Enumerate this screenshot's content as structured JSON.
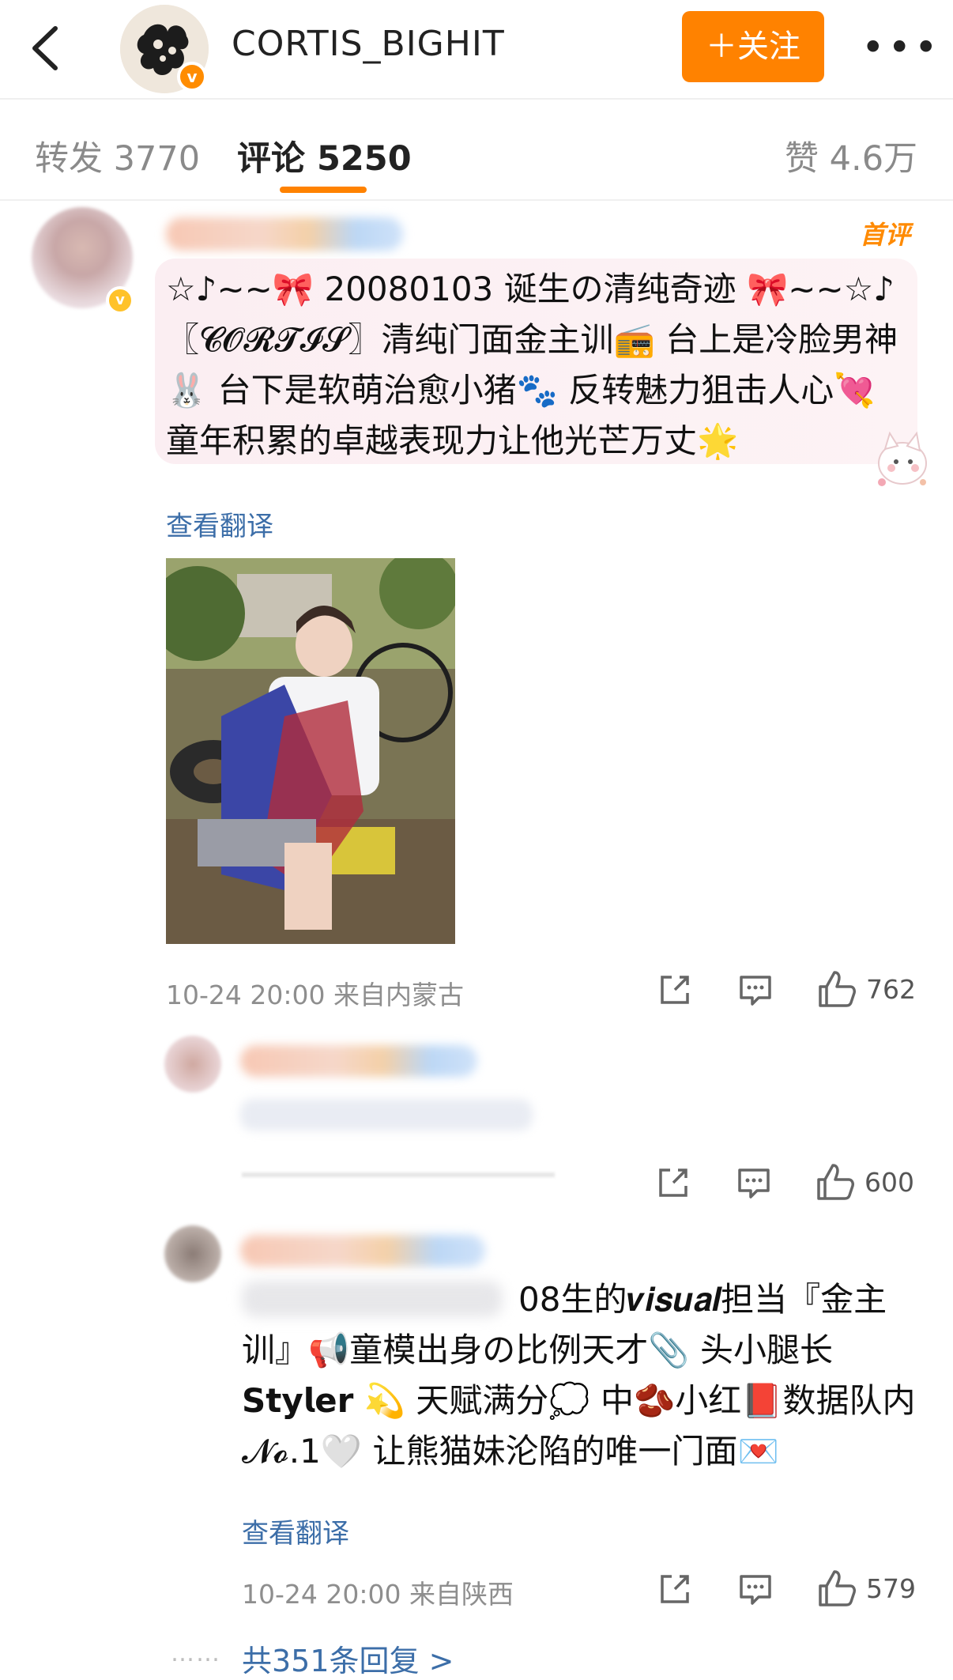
{
  "header": {
    "title": "CORTIS_BIGHIT",
    "follow_label": "＋关注",
    "more_label": "•••",
    "verified_mark": "v"
  },
  "tabs": {
    "repost": "转发 3770",
    "comment": "评论 5250",
    "like": "赞 4.6万"
  },
  "comments": [
    {
      "first_badge": "首评",
      "verified_mark": "v",
      "text": "☆♪~~🎀 20080103 诞生の清纯奇迹 🎀~~☆♪ 〖𝓒𝓞𝓡𝓣𝓘𝓢〗清纯门面金主训📻 台上是冷脸男神🐰 台下是软萌治愈小猪🐾 反转魅力狙击人心💘 童年积累的卓越表现力让他光芒万丈🌟",
      "translate_label": "查看翻译",
      "meta": "10-24 20:00  来自内蒙古",
      "likes": "762",
      "replies": [
        {
          "likes": "600"
        },
        {
          "text": "08生的𝒗𝒊𝒔𝒖𝒂𝒍担当『金主训』📢童模出身の比例天才📎 头小腿长𝗦𝘁𝘆𝗹𝗲𝗿 💫 天赋满分💭 中🫘小红📕数据队内𝓝𝓸.1🤍 让熊猫妹沦陷的唯一门面💌",
          "translate_label": "查看翻译",
          "meta": "10-24 20:00  来自陕西",
          "likes": "579",
          "more_replies_label": "共351条回复 >",
          "dots": "……"
        }
      ]
    }
  ],
  "colors": {
    "accent": "#ff8200",
    "link": "#3c6ea8"
  }
}
